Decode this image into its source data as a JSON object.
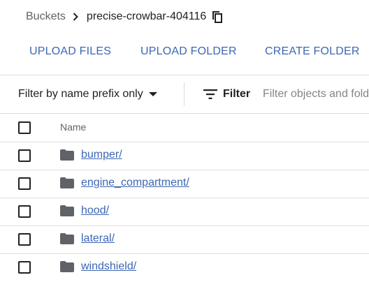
{
  "breadcrumb": {
    "root": "Buckets",
    "current": "precise-crowbar-404116"
  },
  "actions": {
    "upload_files": "UPLOAD FILES",
    "upload_folder": "UPLOAD FOLDER",
    "create_folder": "CREATE FOLDER"
  },
  "filter": {
    "prefix_mode": "Filter by name prefix only",
    "label": "Filter",
    "placeholder": "Filter objects and folders"
  },
  "table": {
    "column_name": "Name",
    "rows": [
      {
        "name": "bumper/"
      },
      {
        "name": "engine_compartment/"
      },
      {
        "name": "hood/"
      },
      {
        "name": "lateral/"
      },
      {
        "name": "windshield/"
      }
    ]
  },
  "icons": {
    "separator": "chevron-right-icon",
    "copy": "copy-icon",
    "caret": "arrow-drop-down-icon",
    "filter": "filter-list-icon",
    "folder": "folder-icon"
  },
  "colors": {
    "accent": "#3c67b3",
    "muted": "#5f6368",
    "divider": "#dadce0"
  }
}
